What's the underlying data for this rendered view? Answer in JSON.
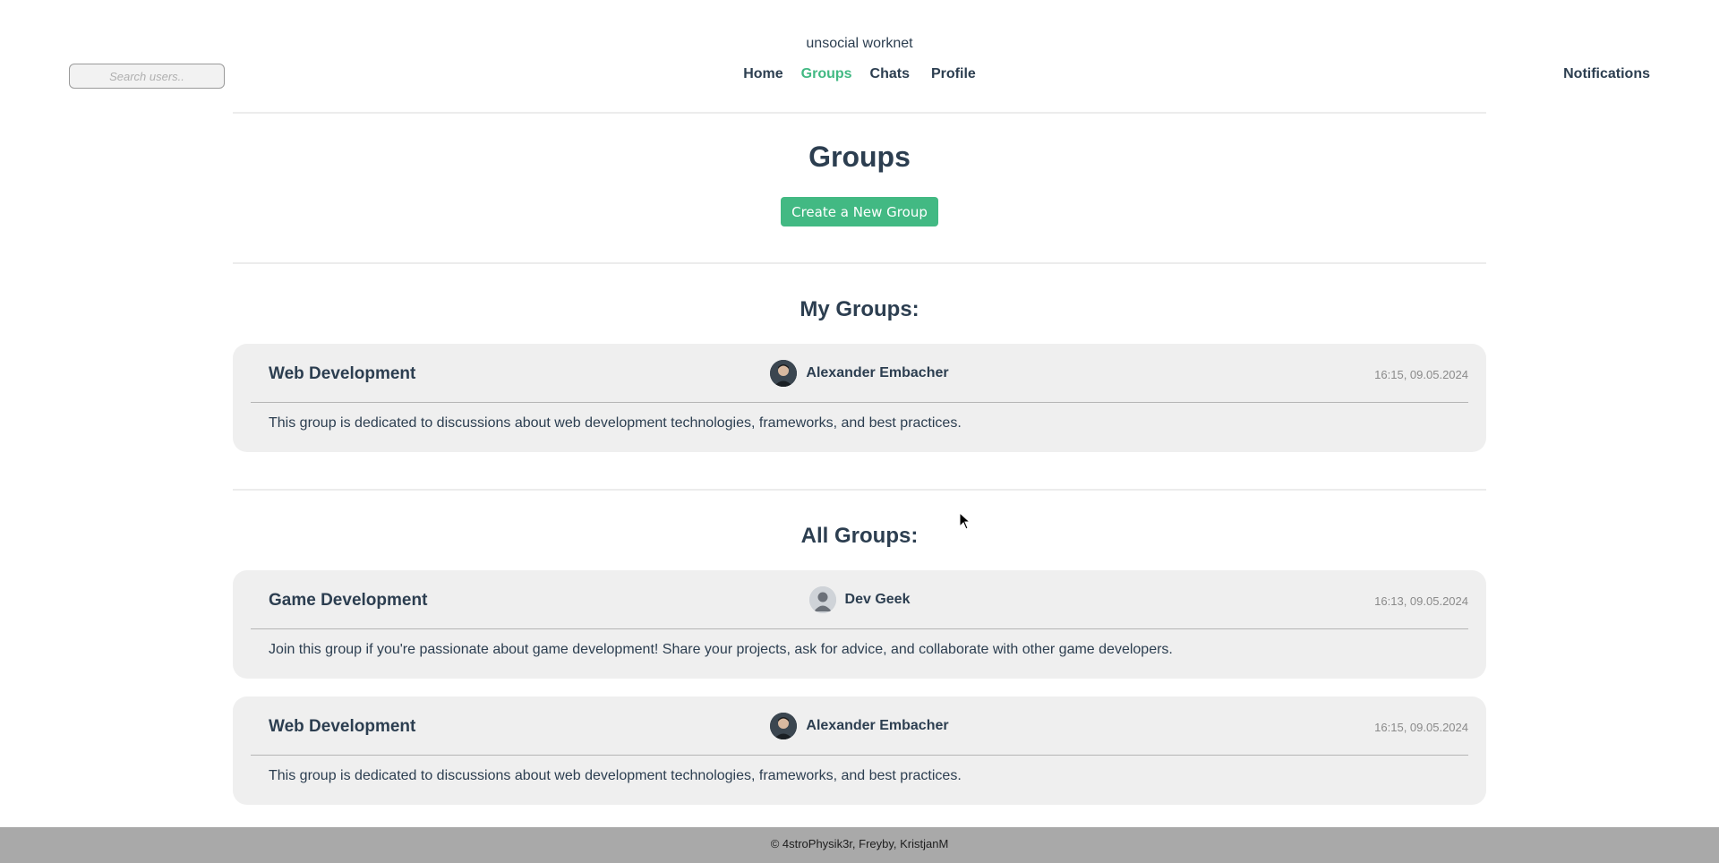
{
  "header": {
    "brand": "unsocial worknet",
    "search_placeholder": "Search users..",
    "nav": {
      "home": "Home",
      "groups": "Groups",
      "chats": "Chats",
      "profile": "Profile"
    },
    "notifications": "Notifications",
    "active_color": "#42b983"
  },
  "page": {
    "title": "Groups",
    "create_button": "Create a New Group"
  },
  "my_groups": {
    "heading": "My Groups:",
    "items": [
      {
        "name": "Web Development",
        "author": "Alexander Embacher",
        "avatar": "photo-avatar",
        "date": "16:15, 09.05.2024",
        "description": "This group is dedicated to discussions about web development technologies, frameworks, and best practices."
      }
    ]
  },
  "all_groups": {
    "heading": "All Groups:",
    "items": [
      {
        "name": "Game Development",
        "author": "Dev Geek",
        "avatar": "default-user-icon",
        "date": "16:13, 09.05.2024",
        "description": "Join this group if you're passionate about game development! Share your projects, ask for advice, and collaborate with other game developers."
      },
      {
        "name": "Web Development",
        "author": "Alexander Embacher",
        "avatar": "photo-avatar",
        "date": "16:15, 09.05.2024",
        "description": "This group is dedicated to discussions about web development technologies, frameworks, and best practices."
      }
    ]
  },
  "footer": {
    "credits": "© 4stroPhysik3r, Freyby, KristjanM"
  }
}
